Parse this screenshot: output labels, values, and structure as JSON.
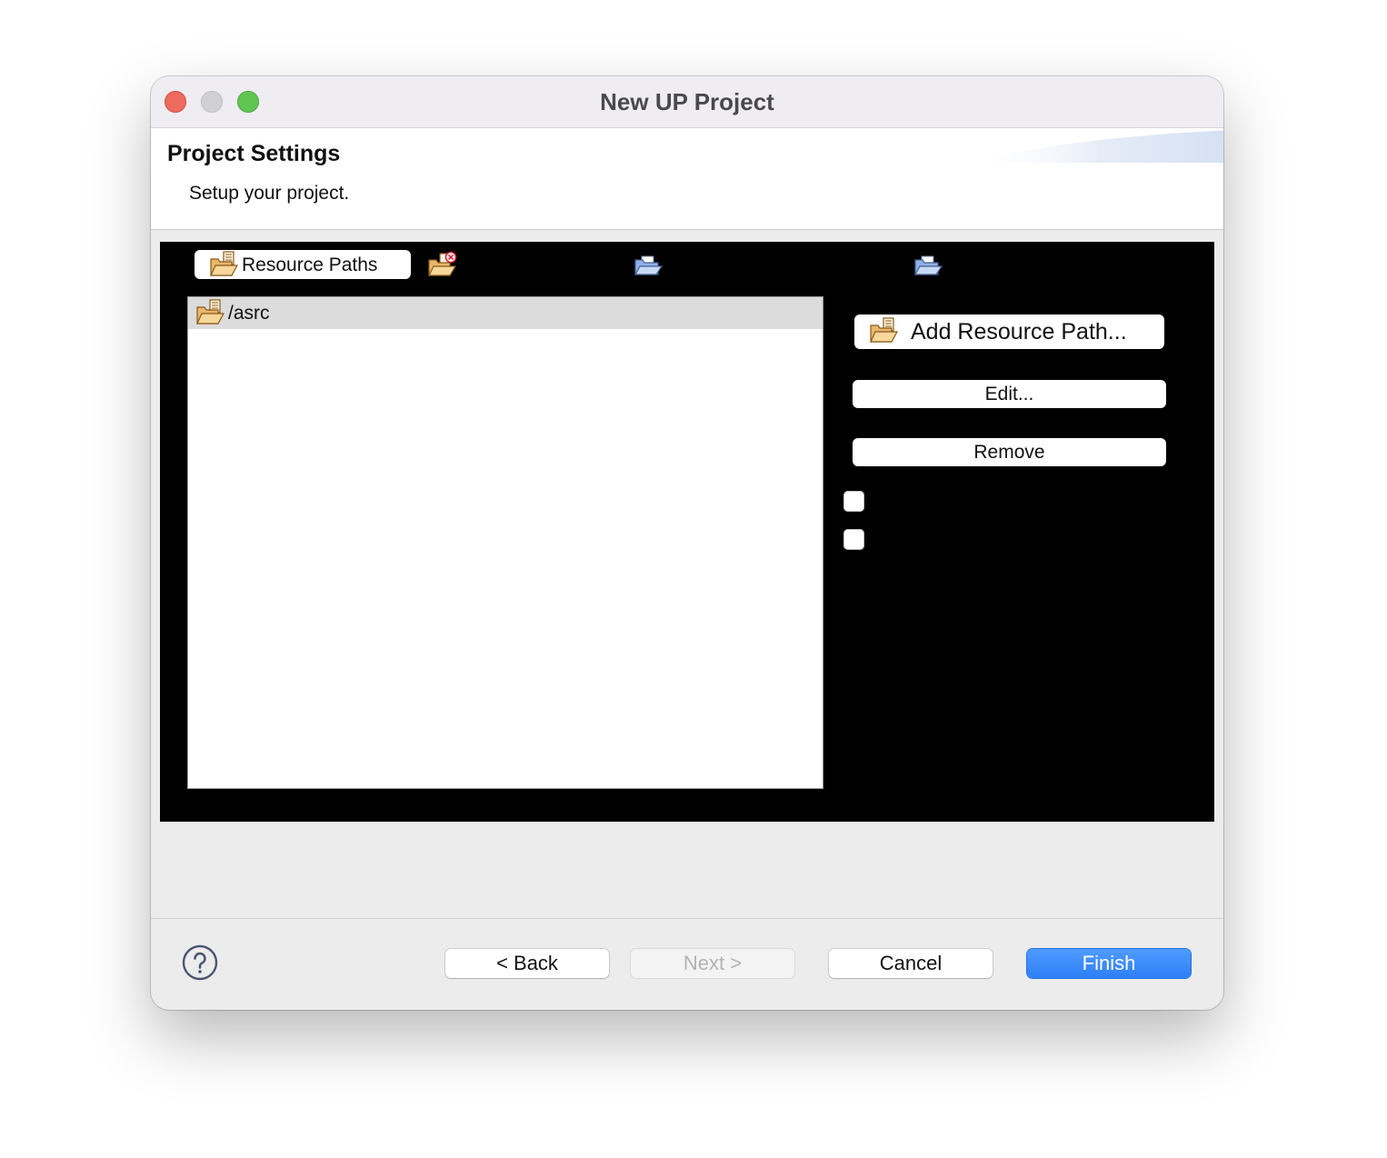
{
  "window": {
    "title": "New UP Project"
  },
  "header": {
    "title": "Project Settings",
    "subtitle": "Setup your project."
  },
  "tabs": [
    {
      "label": "Resource Paths",
      "icon": "resource-folder-icon",
      "selected": true
    },
    {
      "label": "",
      "icon": "folder-error-icon"
    },
    {
      "label": "",
      "icon": "blue-folder-icon"
    },
    {
      "label": "",
      "icon": "blue-folder-icon"
    }
  ],
  "resource_list": {
    "items": [
      {
        "label": "/asrc",
        "icon": "resource-folder-icon",
        "selected": true
      }
    ]
  },
  "side_buttons": {
    "add_label": "Add Resource Path...",
    "edit_label": "Edit...",
    "remove_label": "Remove"
  },
  "checkboxes": [
    {
      "checked": false
    },
    {
      "checked": false
    }
  ],
  "footer": {
    "help_icon": "question-mark-icon",
    "back_label": "< Back",
    "next_label": "Next >",
    "cancel_label": "Cancel",
    "finish_label": "Finish"
  },
  "colors": {
    "accent": "#3485fa",
    "close": "#ed6a5e",
    "minimize": "#d1d0d5",
    "maximize": "#61c554",
    "content_background": "#000000"
  }
}
